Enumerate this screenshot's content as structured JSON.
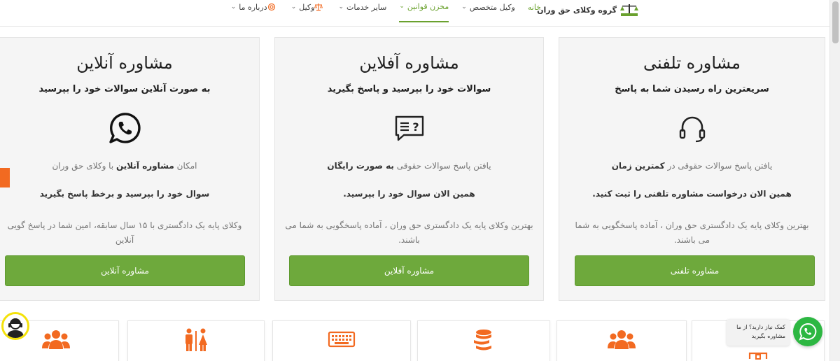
{
  "header": {
    "logo_text": "گروه وکلای حق وران",
    "nav": [
      {
        "label": "خانه",
        "active": true
      },
      {
        "label": "وکیل متخصص",
        "dropdown": true
      },
      {
        "label": "مخزن قوانین",
        "dropdown": true
      },
      {
        "label": "سایر خدمات",
        "dropdown": true
      },
      {
        "label": "وکیل",
        "dropdown": true,
        "icon": "scales-icon"
      },
      {
        "label": "درباره ما",
        "dropdown": true,
        "icon": "support-icon"
      }
    ]
  },
  "cards": [
    {
      "title": "مشاوره تلفنی",
      "subtitle": "سریعترین راه رسیدن شما به پاسخ",
      "icon": "headset-icon",
      "line1_pre": "یافتن پاسخ سوالات حقوقی در ",
      "line1_bold": "کمترین زمان",
      "line1_post": "",
      "line2": "همین الان درخواست مشاوره تلفنی را ثبت کنید.",
      "line3": "بهترین وکلای پایه یک دادگستری حق وران ، آماده پاسخگویی به شما می باشند.",
      "button": "مشاوره تلفنی"
    },
    {
      "title": "مشاوره آفلاین",
      "subtitle": "سوالات خود را بپرسید و پاسخ بگیرید",
      "icon": "question-chat-icon",
      "line1_pre": "یافتن پاسخ سوالات حقوقی ",
      "line1_bold": "به صورت رایگان",
      "line1_post": "",
      "line2": "همین الان سوال خود را بپرسید.",
      "line3": "بهترین وکلای پایه یک دادگستری حق وران ، آماده پاسخگویی به شما می باشند.",
      "button": "مشاوره آفلاین"
    },
    {
      "title": "مشاوره آنلاین",
      "subtitle": "به صورت آنلاین سوالات خود را بپرسید",
      "icon": "whatsapp-icon",
      "line1_pre": "امکان ",
      "line1_bold": "مشاوره آنلاین",
      "line1_post": " با وکلای حق وران",
      "line2": "سوال خود را بپرسید و برخط پاسخ بگیرید",
      "line3": "وکلای پایه یک دادگستری با ۱۵ سال سابقه، امین شما در پاسخ گویی آنلاین",
      "button": "مشاوره آنلاین"
    }
  ],
  "tiles": [
    "users-icon",
    "family-icon",
    "keyboard-icon",
    "coins-icon",
    "users-icon",
    "building-icon"
  ],
  "chat": {
    "bubble_text": "کمک نیاز دارید؟ از ما مشاوره بگیرید"
  },
  "colors": {
    "accent_green": "#6ea93c",
    "accent_orange": "#f26a21",
    "whatsapp": "#2db742"
  }
}
